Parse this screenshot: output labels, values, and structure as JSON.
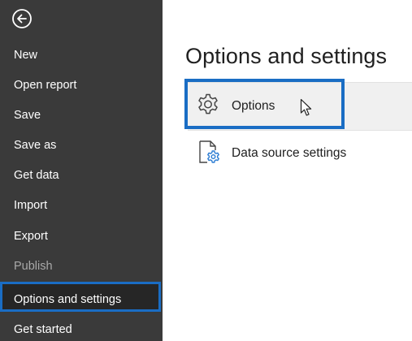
{
  "sidebar": {
    "back_icon": "back-arrow-circle-icon",
    "items": [
      {
        "label": "New",
        "enabled": true
      },
      {
        "label": "Open report",
        "enabled": true
      },
      {
        "label": "Save",
        "enabled": true
      },
      {
        "label": "Save as",
        "enabled": true
      },
      {
        "label": "Get data",
        "enabled": true
      },
      {
        "label": "Import",
        "enabled": true
      },
      {
        "label": "Export",
        "enabled": true
      },
      {
        "label": "Publish",
        "enabled": false
      },
      {
        "label": "Options and settings",
        "enabled": true,
        "selected": true
      },
      {
        "label": "Get started",
        "enabled": true
      }
    ]
  },
  "main": {
    "title": "Options and settings",
    "options": [
      {
        "label": "Options",
        "icon": "gear-icon",
        "highlighted": true
      },
      {
        "label": "Data source settings",
        "icon": "document-gear-icon"
      }
    ]
  },
  "colors": {
    "sidebar_bg": "#3a3a3a",
    "highlight": "#1a6dc4",
    "disabled_text": "#a9a9a9",
    "row_hover_bg": "#f0f0f0"
  }
}
